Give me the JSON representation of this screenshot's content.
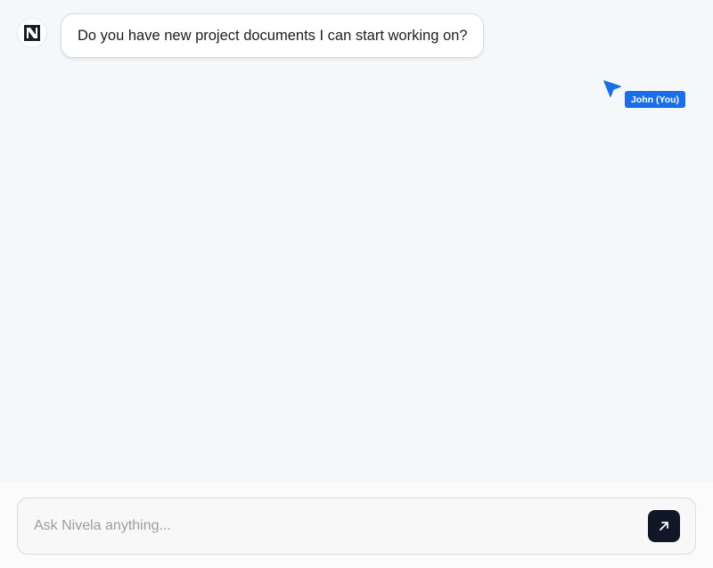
{
  "chat": {
    "assistant_logo": "N",
    "messages": [
      {
        "role": "assistant",
        "text": "Do you have new project documents I can start working on?"
      }
    ]
  },
  "cursor": {
    "label": "John (You)",
    "color": "#1a6ee8",
    "icon": "pointer-cursor-icon"
  },
  "composer": {
    "placeholder": "Ask Nivela anything...",
    "value": "",
    "send_icon": "arrow-up-right-icon",
    "send_color": "#101827"
  }
}
